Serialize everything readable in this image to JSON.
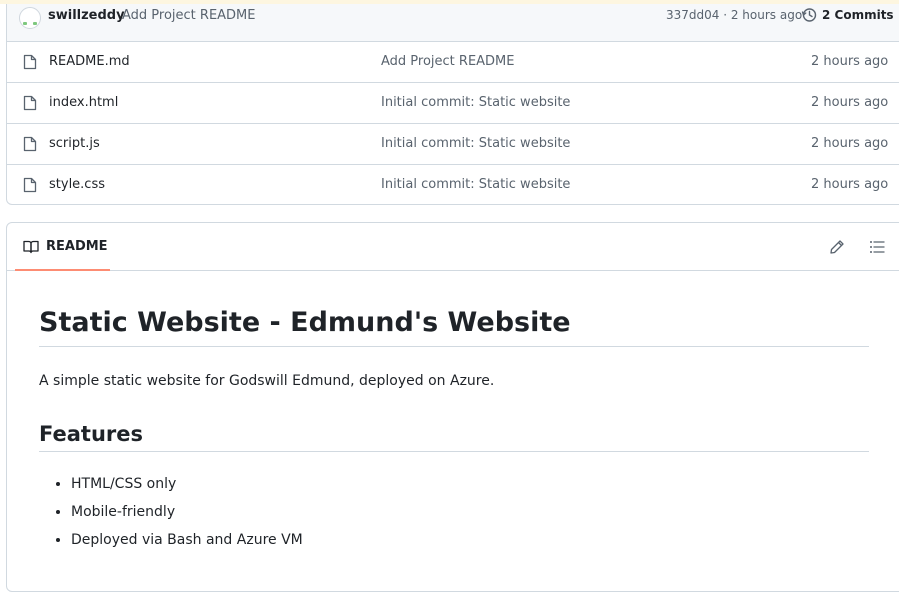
{
  "commit": {
    "author": "swillzeddy",
    "message": "Add Project README",
    "meta": "337dd04 · 2 hours ago",
    "commits_count": "2 Commits"
  },
  "files": [
    {
      "name": "README.md",
      "commit": "Add Project README",
      "time": "2 hours ago",
      "icon": "file-icon"
    },
    {
      "name": "index.html",
      "commit": "Initial commit: Static website",
      "time": "2 hours ago",
      "icon": "file-icon"
    },
    {
      "name": "script.js",
      "commit": "Initial commit: Static website",
      "time": "2 hours ago",
      "icon": "file-icon"
    },
    {
      "name": "style.css",
      "commit": "Initial commit: Static website",
      "time": "2 hours ago",
      "icon": "file-icon"
    }
  ],
  "readme": {
    "tab_label": "README",
    "title": "Static Website - Edmund's Website",
    "description": "A simple static website for Godswill Edmund, deployed on Azure.",
    "features_heading": "Features",
    "features": [
      "HTML/CSS only",
      "Mobile-friendly",
      "Deployed via Bash and Azure VM"
    ]
  },
  "colors": {
    "accent_underline": "#fd8c73",
    "border": "#d1d9e0",
    "muted_text": "#59636e"
  }
}
